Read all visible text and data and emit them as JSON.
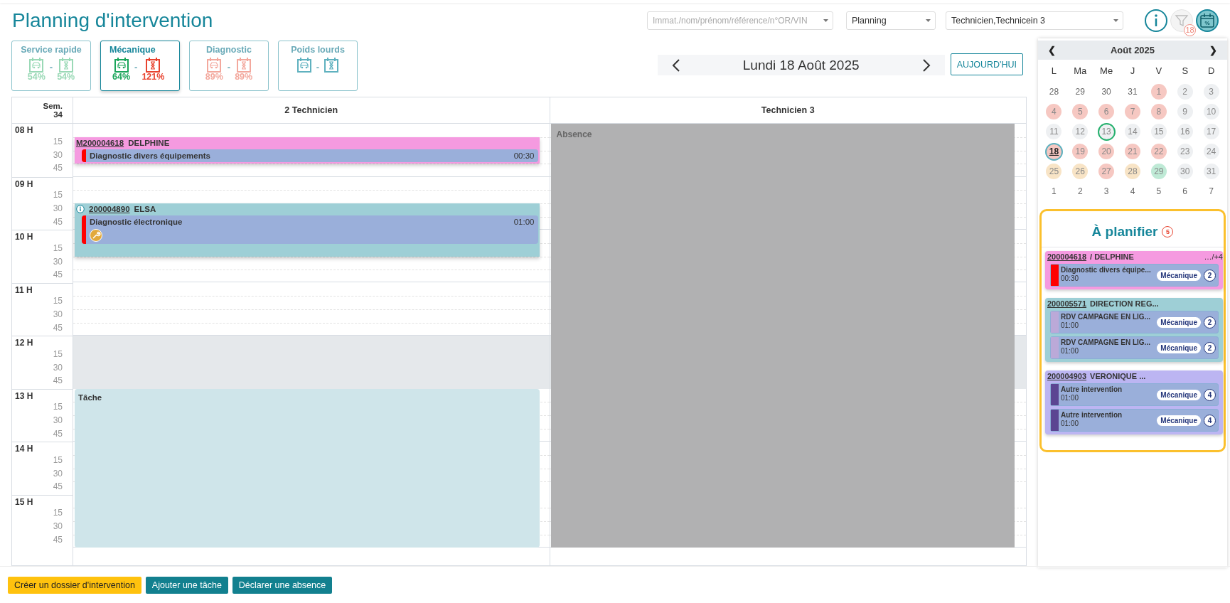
{
  "title": "Planning d'intervention",
  "filters": {
    "search": {
      "placeholder": "Immat./nom/prénom/référence/n°OR/VIN"
    },
    "view": {
      "value": "Planning"
    },
    "technicians": {
      "value": "Technicien,Technicein 3"
    },
    "filter_badge": "18",
    "occupancy_icon_label": "%"
  },
  "categories": [
    {
      "label": "Service rapide",
      "selected": false,
      "separator": "-",
      "stats": [
        {
          "value": "54%",
          "color": "#9ad9b6"
        },
        {
          "value": "54%",
          "color": "#9ad9b6"
        }
      ]
    },
    {
      "label": "Mécanique",
      "selected": true,
      "separator": "-",
      "stats": [
        {
          "value": "64%",
          "color": "#1aa55a"
        },
        {
          "value": "121%",
          "color": "#e8432f"
        }
      ]
    },
    {
      "label": "Diagnostic",
      "selected": false,
      "separator": "-",
      "stats": [
        {
          "value": "89%",
          "color": "#f3a89d"
        },
        {
          "value": "89%",
          "color": "#f3a89d"
        }
      ]
    },
    {
      "label": "Poids lourds",
      "selected": false,
      "separator": "-",
      "stats": [
        {
          "color": "#5fb1bf"
        },
        {
          "color": "#5fb1bf"
        }
      ]
    }
  ],
  "date_nav": {
    "date": "Lundi 18 Août 2025",
    "today_button": "AUJOURD'HUI"
  },
  "planning": {
    "week_label": "Sem.",
    "week_number": "34",
    "hours": [
      {
        "label": "08 H",
        "quarters": [
          "15",
          "30",
          "45"
        ],
        "break": false
      },
      {
        "label": "09 H",
        "quarters": [
          "15",
          "30",
          "45"
        ],
        "break": false
      },
      {
        "label": "10 H",
        "quarters": [
          "15",
          "30",
          "45"
        ],
        "break": false
      },
      {
        "label": "11 H",
        "quarters": [
          "15",
          "30",
          "45"
        ],
        "break": false
      },
      {
        "label": "12 H",
        "quarters": [
          "15",
          "30",
          "45"
        ],
        "break": true
      },
      {
        "label": "13 H",
        "quarters": [
          "15",
          "30",
          "45"
        ],
        "break": false
      },
      {
        "label": "14 H",
        "quarters": [
          "15",
          "30",
          "45"
        ],
        "break": false
      },
      {
        "label": "15 H",
        "quarters": [
          "15",
          "30",
          "45"
        ],
        "break": false
      }
    ],
    "columns": [
      {
        "title": "2 Technicien",
        "events": [
          {
            "kind": "appointment",
            "color": "#f59ae0",
            "info": false,
            "ref": "M200004618",
            "name": "DELPHINE",
            "tasks": [
              {
                "title": "Diagnostic divers équipements",
                "duration": "00:30",
                "color": "#ff0000",
                "tool": false
              }
            ]
          },
          {
            "kind": "appointment",
            "color": "#9ecfd6",
            "info": true,
            "ref": "200004890",
            "name": "ELSA",
            "tasks": [
              {
                "title": "Diagnostic électronique",
                "duration": "01:00",
                "color": "#ff0000",
                "tool": true
              }
            ]
          },
          {
            "kind": "task",
            "color": "#cfe5ea",
            "label": "Tâche"
          }
        ]
      },
      {
        "title": "Technicien 3",
        "events": [
          {
            "kind": "absence",
            "color": "#b1b1b2",
            "label": "Absence"
          }
        ]
      }
    ]
  },
  "calendar": {
    "month": "Août 2025",
    "prev": "❮",
    "next": "❯",
    "weekdays": [
      "L",
      "Ma",
      "Me",
      "J",
      "V",
      "S",
      "D"
    ],
    "days": [
      {
        "label": "28",
        "other_month": true,
        "today": false,
        "selected": false
      },
      {
        "label": "29",
        "other_month": true,
        "today": false,
        "selected": false
      },
      {
        "label": "30",
        "other_month": true,
        "today": false,
        "selected": false
      },
      {
        "label": "31",
        "other_month": true,
        "today": false,
        "selected": false
      },
      {
        "label": "1",
        "other_month": false,
        "color": "#f6c8c2",
        "today": false,
        "selected": false
      },
      {
        "label": "2",
        "other_month": false,
        "color": "#eef0f2",
        "today": false,
        "selected": false
      },
      {
        "label": "3",
        "other_month": false,
        "color": "#eef0f2",
        "today": false,
        "selected": false
      },
      {
        "label": "4",
        "other_month": false,
        "color": "#f6c8c2",
        "today": false,
        "selected": false
      },
      {
        "label": "5",
        "other_month": false,
        "color": "#f6c8c2",
        "today": false,
        "selected": false
      },
      {
        "label": "6",
        "other_month": false,
        "color": "#f6c8c2",
        "today": false,
        "selected": false
      },
      {
        "label": "7",
        "other_month": false,
        "color": "#f6c8c2",
        "today": false,
        "selected": false
      },
      {
        "label": "8",
        "other_month": false,
        "color": "#f6c8c2",
        "today": false,
        "selected": false
      },
      {
        "label": "9",
        "other_month": false,
        "color": "#eef0f2",
        "today": false,
        "selected": false
      },
      {
        "label": "10",
        "other_month": false,
        "color": "#eef0f2",
        "today": false,
        "selected": false
      },
      {
        "label": "11",
        "other_month": false,
        "color": "#eef0f2",
        "today": false,
        "selected": false
      },
      {
        "label": "12",
        "other_month": false,
        "color": "#eef0f2",
        "today": false,
        "selected": false
      },
      {
        "label": "13",
        "other_month": false,
        "color": "#eef0f2",
        "today": true,
        "selected": false
      },
      {
        "label": "14",
        "other_month": false,
        "color": "#eef0f2",
        "today": false,
        "selected": false
      },
      {
        "label": "15",
        "other_month": false,
        "color": "#eef0f2",
        "today": false,
        "selected": false
      },
      {
        "label": "16",
        "other_month": false,
        "color": "#eef0f2",
        "today": false,
        "selected": false
      },
      {
        "label": "17",
        "other_month": false,
        "color": "#eef0f2",
        "today": false,
        "selected": false
      },
      {
        "label": "18",
        "other_month": false,
        "color": "#f6c8c2",
        "today": false,
        "selected": true
      },
      {
        "label": "19",
        "other_month": false,
        "color": "#f6c8c2",
        "today": false,
        "selected": false
      },
      {
        "label": "20",
        "other_month": false,
        "color": "#f6c8c2",
        "today": false,
        "selected": false
      },
      {
        "label": "21",
        "other_month": false,
        "color": "#f6c8c2",
        "today": false,
        "selected": false
      },
      {
        "label": "22",
        "other_month": false,
        "color": "#f6c8c2",
        "today": false,
        "selected": false
      },
      {
        "label": "23",
        "other_month": false,
        "color": "#eef0f2",
        "today": false,
        "selected": false
      },
      {
        "label": "24",
        "other_month": false,
        "color": "#eef0f2",
        "today": false,
        "selected": false
      },
      {
        "label": "25",
        "other_month": false,
        "color": "#f8e4c6",
        "today": false,
        "selected": false
      },
      {
        "label": "26",
        "other_month": false,
        "color": "#f8e4c6",
        "today": false,
        "selected": false
      },
      {
        "label": "27",
        "other_month": false,
        "color": "#f6c8c2",
        "today": false,
        "selected": false
      },
      {
        "label": "28",
        "other_month": false,
        "color": "#f8e4c6",
        "today": false,
        "selected": false
      },
      {
        "label": "29",
        "other_month": false,
        "color": "#bfead6",
        "today": false,
        "selected": false
      },
      {
        "label": "30",
        "other_month": false,
        "color": "#eef0f2",
        "today": false,
        "selected": false
      },
      {
        "label": "31",
        "other_month": false,
        "color": "#eef0f2",
        "today": false,
        "selected": false
      },
      {
        "label": "1",
        "other_month": true,
        "today": false,
        "selected": false
      },
      {
        "label": "2",
        "other_month": true,
        "today": false,
        "selected": false
      },
      {
        "label": "3",
        "other_month": true,
        "today": false,
        "selected": false
      },
      {
        "label": "4",
        "other_month": true,
        "today": false,
        "selected": false
      },
      {
        "label": "5",
        "other_month": true,
        "today": false,
        "selected": false
      },
      {
        "label": "6",
        "other_month": true,
        "today": false,
        "selected": false
      },
      {
        "label": "7",
        "other_month": true,
        "today": false,
        "selected": false
      }
    ]
  },
  "to_plan": {
    "title": "À planifier",
    "count": "5",
    "groups": [
      {
        "ref": "200004618",
        "name": "/ DELPHINE",
        "extra": "…/+4",
        "color": "#f59ae0",
        "items": [
          {
            "title": "Diagnostic divers équipe...",
            "duration": "00:30",
            "color": "#ff0000",
            "tag": "Mécanique",
            "count": "2"
          }
        ]
      },
      {
        "ref": "200005571",
        "name": "DIRECTION REG...",
        "color": "#9ecfd6",
        "items": [
          {
            "title": "RDV CAMPAGNE EN LIG...",
            "duration": "01:00",
            "color": "#bba9d8",
            "tag": "Mécanique",
            "count": "2"
          },
          {
            "title": "RDV CAMPAGNE EN LIG...",
            "duration": "01:00",
            "color": "#bba9d8",
            "tag": "Mécanique",
            "count": "2"
          }
        ]
      },
      {
        "ref": "200004903",
        "name": "VERONIQUE ...",
        "color": "#bcb5f2",
        "items": [
          {
            "title": "Autre intervention",
            "duration": "01:00",
            "color": "#5b4592",
            "tag": "Mécanique",
            "count": "4"
          },
          {
            "title": "Autre intervention",
            "duration": "01:00",
            "color": "#5b4592",
            "tag": "Mécanique",
            "count": "4"
          }
        ]
      }
    ]
  },
  "actions": [
    {
      "label": "Créer un dossier d'intervention",
      "kind": "primary"
    },
    {
      "label": "Ajouter une tâche",
      "kind": "secondary"
    },
    {
      "label": "Déclarer une absence",
      "kind": "secondary"
    }
  ]
}
